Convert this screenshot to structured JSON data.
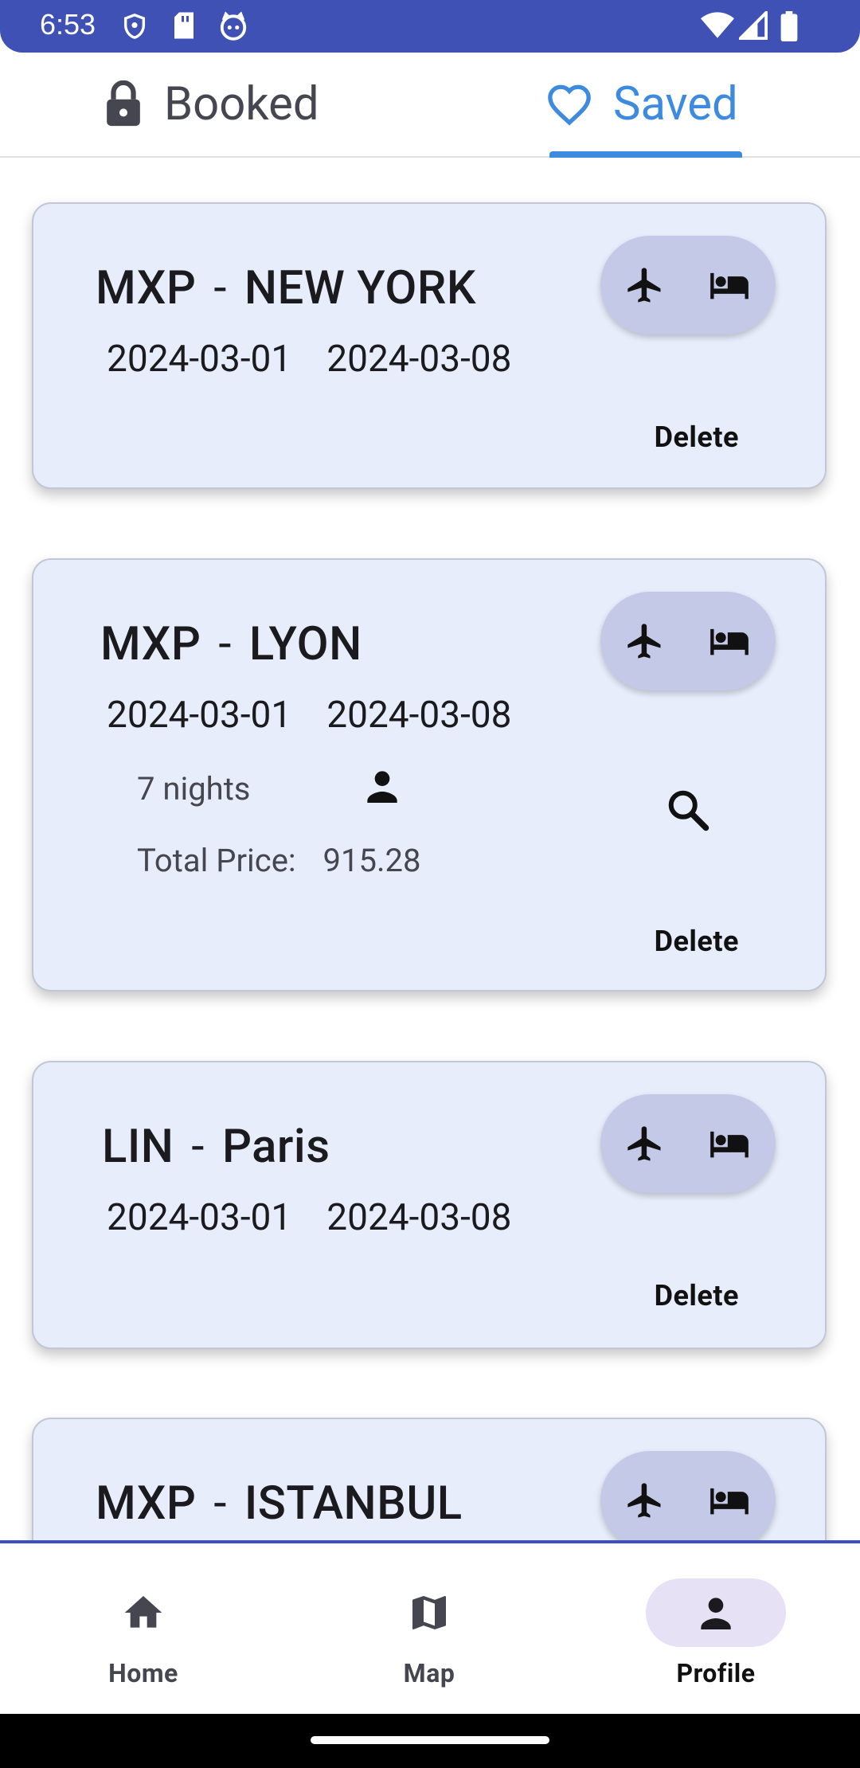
{
  "status_bar": {
    "time": "6:53"
  },
  "tabs": [
    {
      "label": "Booked",
      "icon": "lock-icon",
      "active": false
    },
    {
      "label": "Saved",
      "icon": "heart-outline-icon",
      "active": true
    }
  ],
  "colors": {
    "accent": "#3d8be0",
    "status_bar": "#3f51b5",
    "card_bg": "#e8edfb",
    "pill_bg": "#c5c9e8",
    "nav_active_bg": "#e6e1f5"
  },
  "trips": [
    {
      "origin": "MXP",
      "separator": "-",
      "destination": "NEW YORK",
      "start_date": "2024-03-01",
      "end_date": "2024-03-08",
      "delete_label": "Delete"
    },
    {
      "origin": "MXP",
      "separator": "-",
      "destination": "LYON",
      "start_date": "2024-03-01",
      "end_date": "2024-03-08",
      "nights": "7 nights",
      "total_price_label": "Total Price:",
      "total_price": "915.28",
      "delete_label": "Delete"
    },
    {
      "origin": "LIN",
      "separator": "-",
      "destination": "Paris",
      "start_date": "2024-03-01",
      "end_date": "2024-03-08",
      "delete_label": "Delete"
    },
    {
      "origin": "MXP",
      "separator": "-",
      "destination": "ISTANBUL"
    }
  ],
  "bottom_nav": [
    {
      "label": "Home",
      "icon": "home-icon",
      "active": false
    },
    {
      "label": "Map",
      "icon": "map-icon",
      "active": false
    },
    {
      "label": "Profile",
      "icon": "person-icon",
      "active": true
    }
  ]
}
